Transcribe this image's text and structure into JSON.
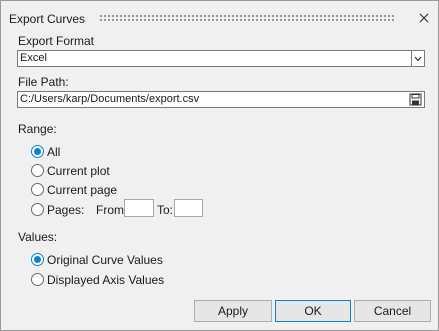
{
  "dialog": {
    "title": "Export Curves"
  },
  "export_format": {
    "label": "Export Format",
    "selected": "Excel"
  },
  "file_path": {
    "label": "File Path:",
    "value": "C:/Users/karp/Documents/export.csv"
  },
  "range": {
    "label": "Range:",
    "options": [
      {
        "label": "All",
        "selected": true
      },
      {
        "label": "Current plot",
        "selected": false
      },
      {
        "label": "Current page",
        "selected": false
      },
      {
        "label": "Pages:",
        "selected": false
      }
    ],
    "from_label": "From:",
    "to_label": "To:",
    "from_value": "",
    "to_value": ""
  },
  "values": {
    "label": "Values:",
    "options": [
      {
        "label": "Original Curve Values",
        "selected": true
      },
      {
        "label": "Displayed Axis Values",
        "selected": false
      }
    ]
  },
  "buttons": {
    "apply": "Apply",
    "ok": "OK",
    "cancel": "Cancel"
  },
  "colors": {
    "accent": "#0a84c7",
    "background": "#f0f0f0"
  }
}
